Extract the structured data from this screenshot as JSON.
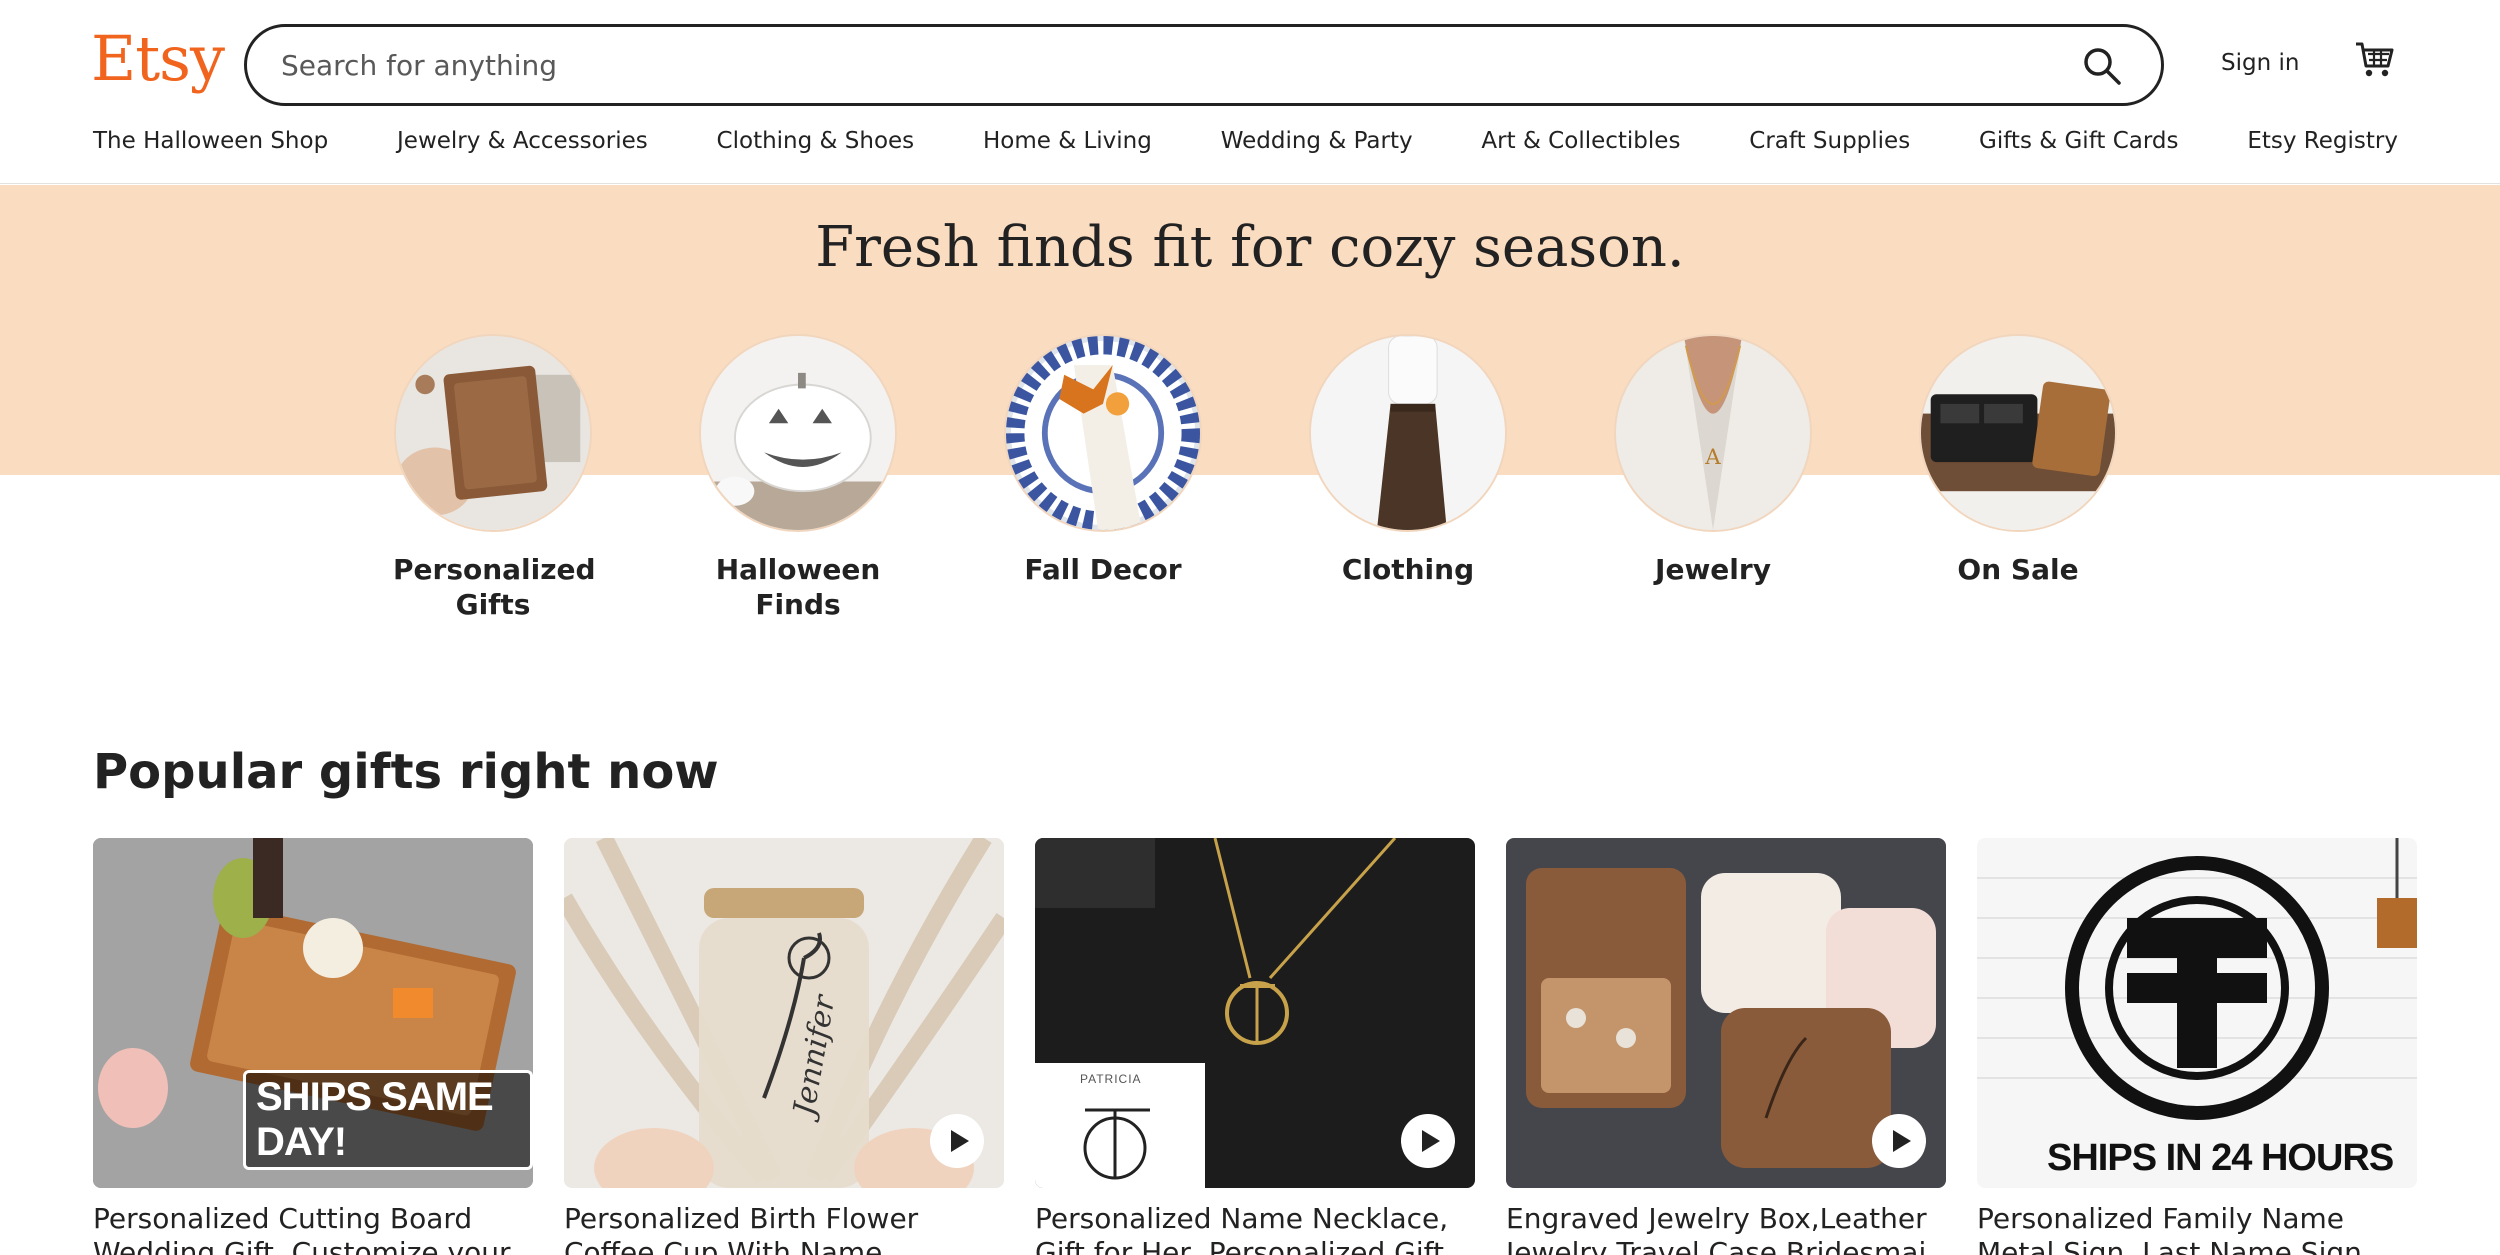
{
  "header": {
    "logo": "Etsy",
    "search_placeholder": "Search for anything",
    "sign_in": "Sign in"
  },
  "nav": [
    "The Halloween Shop",
    "Jewelry & Accessories",
    "Clothing & Shoes",
    "Home & Living",
    "Wedding & Party",
    "Art & Collectibles",
    "Craft Supplies",
    "Gifts & Gift Cards",
    "Etsy Registry"
  ],
  "hero": {
    "title": "Fresh finds fit for cozy season.",
    "categories": [
      {
        "label": "Personalized Gifts",
        "icon": "recipe-book-image"
      },
      {
        "label": "Halloween Finds",
        "icon": "white-pumpkin-image"
      },
      {
        "label": "Fall Decor",
        "icon": "fall-napkin-plate-image"
      },
      {
        "label": "Clothing",
        "icon": "brown-skirt-image"
      },
      {
        "label": "Jewelry",
        "icon": "initial-necklace-image"
      },
      {
        "label": "On Sale",
        "icon": "leather-wallet-image"
      }
    ]
  },
  "popular": {
    "title": "Popular gifts right now",
    "items": [
      {
        "title": "Personalized Cutting Board Wedding Gift, Customize your",
        "overlay": "SHIPS SAME DAY!",
        "has_video": false
      },
      {
        "title": "Personalized Birth Flower Coffee Cup With Name, Personalized",
        "overlay": "Jennifer",
        "has_video": true
      },
      {
        "title": "Personalized Name Necklace, Gift for Her, Personalized Gift",
        "overlay": "PATRICIA",
        "has_video": true
      },
      {
        "title": "Engraved Jewelry Box,Leather Jewelry Travel Case,Bridesmai",
        "overlay": "",
        "has_video": true
      },
      {
        "title": "Personalized Family Name Metal Sign, Last Name Sign, Initial",
        "overlay": "SHIPS IN 24 HOURS",
        "has_video": false
      }
    ]
  },
  "colors": {
    "brand": "#f1641e",
    "hero_band": "#fadcc1",
    "text": "#222222"
  }
}
